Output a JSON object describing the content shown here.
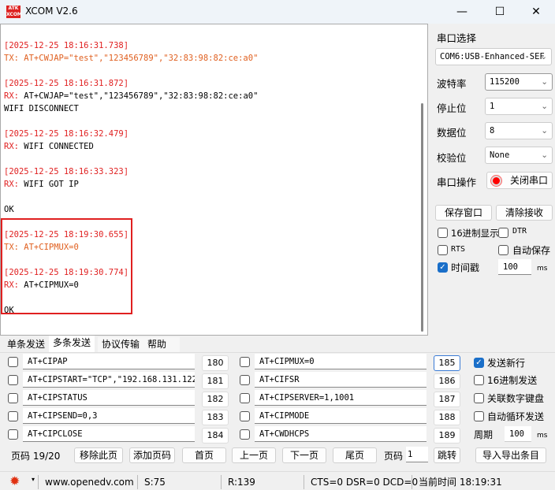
{
  "window": {
    "title": "XCOM V2.6",
    "logo": "ATK XCOM",
    "minimize": "—",
    "maximize": "☐",
    "close": "✕"
  },
  "log": [
    {
      "cls": "ts",
      "text": "[2025-12-25 18:16:31.738]"
    },
    {
      "cls": "tx",
      "text": "TX: AT+CWJAP=\"test\",\"123456789\",\"32:83:98:82:ce:a0\""
    },
    {
      "cls": "",
      "text": ""
    },
    {
      "cls": "ts",
      "text": "[2025-12-25 18:16:31.872]"
    },
    {
      "cls": "rxl",
      "prefix": "RX:",
      "text": " AT+CWJAP=\"test\",\"123456789\",\"32:83:98:82:ce:a0\""
    },
    {
      "cls": "",
      "text": "WIFI DISCONNECT"
    },
    {
      "cls": "",
      "text": ""
    },
    {
      "cls": "ts",
      "text": "[2025-12-25 18:16:32.479]"
    },
    {
      "cls": "rxl",
      "prefix": "RX:",
      "text": " WIFI CONNECTED"
    },
    {
      "cls": "",
      "text": ""
    },
    {
      "cls": "ts",
      "text": "[2025-12-25 18:16:33.323]"
    },
    {
      "cls": "rxl",
      "prefix": "RX:",
      "text": " WIFI GOT IP"
    },
    {
      "cls": "",
      "text": ""
    },
    {
      "cls": "",
      "text": "OK"
    },
    {
      "cls": "",
      "text": ""
    },
    {
      "cls": "ts",
      "text": "[2025-12-25 18:19:30.655]"
    },
    {
      "cls": "tx",
      "text": "TX: AT+CIPMUX=0"
    },
    {
      "cls": "",
      "text": ""
    },
    {
      "cls": "ts",
      "text": "[2025-12-25 18:19:30.774]"
    },
    {
      "cls": "rxl",
      "prefix": "RX:",
      "text": " AT+CIPMUX=0"
    },
    {
      "cls": "",
      "text": ""
    },
    {
      "cls": "",
      "text": "OK"
    }
  ],
  "side": {
    "port_label": "串口选择",
    "port": "COM6:USB-Enhanced-SEF",
    "baud_label": "波特率",
    "baud": "115200",
    "stop_label": "停止位",
    "stop": "1",
    "data_label": "数据位",
    "data": "8",
    "parity_label": "校验位",
    "parity": "None",
    "op_label": "串口操作",
    "op_button": "关闭串口",
    "save": "保存窗口",
    "clear": "清除接收",
    "hex_display": "16进制显示",
    "dtr": "DTR",
    "rts": "RTS",
    "autosave": "自动保存",
    "timestamp": "时间戳",
    "timestamp_checked": true,
    "interval": "100",
    "ms": "ms"
  },
  "tabs": [
    "单条发送",
    "多条发送",
    "协议传输",
    "帮助"
  ],
  "active_tab": 1,
  "multi": {
    "left": [
      {
        "cmd": "AT+CIPAP",
        "n": "180"
      },
      {
        "cmd": "AT+CIPSTART=\"TCP\",\"192.168.131.122\",",
        "n": "181"
      },
      {
        "cmd": "AT+CIPSTATUS",
        "n": "182"
      },
      {
        "cmd": "AT+CIPSEND=0,3",
        "n": "183"
      },
      {
        "cmd": "AT+CIPCLOSE",
        "n": "184"
      }
    ],
    "right": [
      {
        "cmd": "AT+CIPMUX=0",
        "n": "185"
      },
      {
        "cmd": "AT+CIFSR",
        "n": "186"
      },
      {
        "cmd": "AT+CIPSERVER=1,1001",
        "n": "187"
      },
      {
        "cmd": "AT+CIPMODE",
        "n": "188"
      },
      {
        "cmd": "AT+CWDHCPS",
        "n": "189"
      }
    ],
    "send_newline": "发送新行",
    "hex_send": "16进制发送",
    "numpad": "关联数字键盘",
    "loop": "自动循环发送",
    "period_label": "周期",
    "period": "100",
    "ms": "ms",
    "page_label": "页码 19/20",
    "remove": "移除此页",
    "add": "添加页码",
    "first": "首页",
    "prev": "上一页",
    "next": "下一页",
    "last": "尾页",
    "goto_label": "页码",
    "goto_value": "1",
    "jump": "跳转",
    "import_export": "导入导出条目"
  },
  "status": {
    "url": "www.openedv.com",
    "s": "S:75",
    "r": "R:139",
    "lines": "CTS=0 DSR=0 DCD=0",
    "time": "当前时间 18:19:31"
  },
  "colors": {
    "timestamp": "#e02020",
    "tx": "#e06020",
    "highlight": "#e02020",
    "accent": "#1a6fc9"
  }
}
